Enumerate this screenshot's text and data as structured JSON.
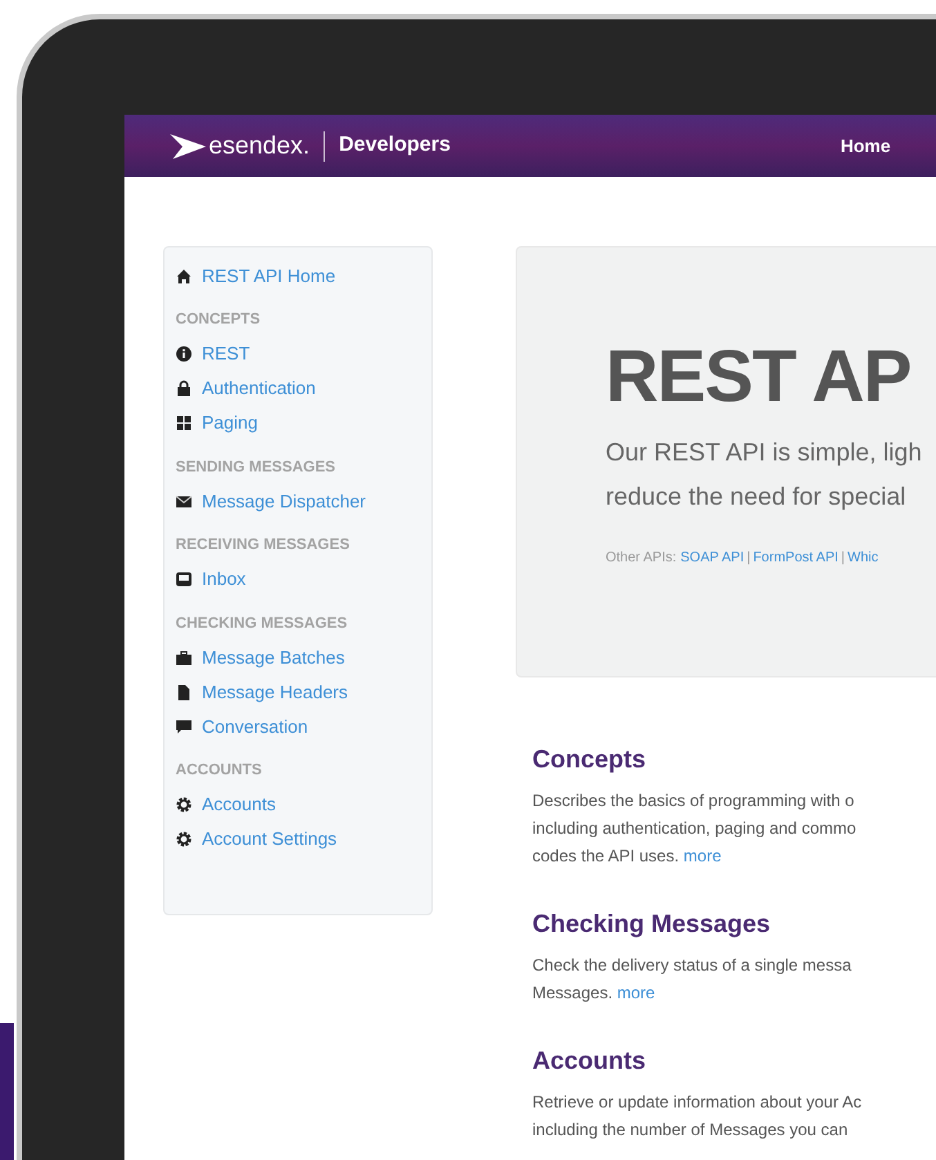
{
  "navbar": {
    "brand": "esendex.",
    "section": "Developers",
    "links": [
      "Home"
    ]
  },
  "sidebar": {
    "home": {
      "label": "REST API Home"
    },
    "groups": [
      {
        "heading": "CONCEPTS",
        "items": [
          {
            "label": "REST"
          },
          {
            "label": "Authentication"
          },
          {
            "label": "Paging"
          }
        ]
      },
      {
        "heading": "SENDING MESSAGES",
        "items": [
          {
            "label": "Message Dispatcher"
          }
        ]
      },
      {
        "heading": "RECEIVING MESSAGES",
        "items": [
          {
            "label": "Inbox"
          }
        ]
      },
      {
        "heading": "CHECKING MESSAGES",
        "items": [
          {
            "label": "Message Batches"
          },
          {
            "label": "Message Headers"
          },
          {
            "label": "Conversation"
          }
        ]
      },
      {
        "heading": "ACCOUNTS",
        "items": [
          {
            "label": "Accounts"
          },
          {
            "label": "Account Settings"
          }
        ]
      }
    ]
  },
  "hero": {
    "title": "REST AP",
    "lines": [
      "Our REST API is simple, ligh",
      "reduce the need for special"
    ],
    "other_label": "Other APIs:",
    "other_links": [
      "SOAP API",
      "FormPost API",
      "Whic"
    ],
    "separators": [
      "|",
      "|"
    ]
  },
  "sections": [
    {
      "heading": "Concepts",
      "lines": [
        "Describes the basics of programming with o",
        "including authentication, paging and commo",
        "codes the API uses."
      ],
      "more": "more"
    },
    {
      "heading": "Checking Messages",
      "lines": [
        "Check the delivery status of a single messa",
        "Messages."
      ],
      "more": "more"
    },
    {
      "heading": "Accounts",
      "lines": [
        "Retrieve or update information about your Ac",
        "including the number of Messages you can"
      ]
    }
  ]
}
